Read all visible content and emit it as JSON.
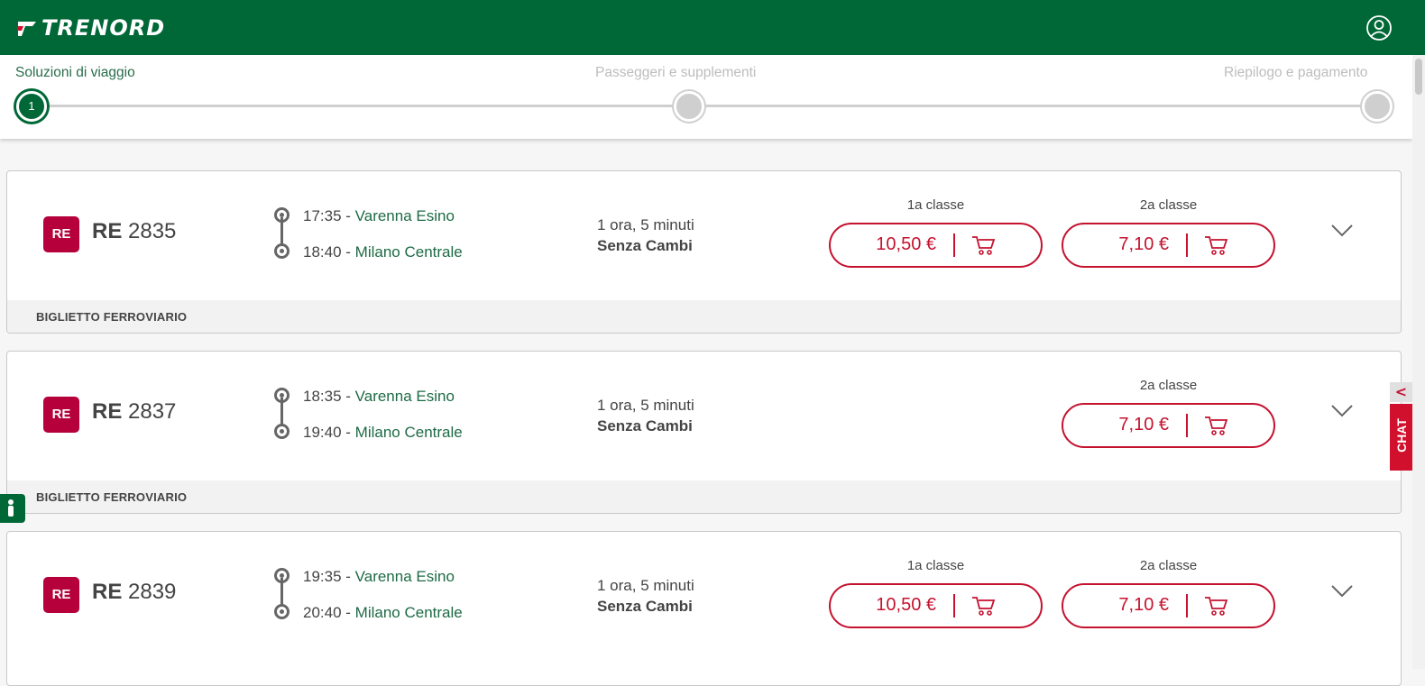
{
  "header": {
    "brand": "TRENORD",
    "user_icon": "user-circle-icon",
    "background": "#006837"
  },
  "stepper": {
    "steps": [
      {
        "label": "Soluzioni di viaggio",
        "number": "1",
        "active": true
      },
      {
        "label": "Passeggeri e supplementi",
        "active": false
      },
      {
        "label": "Riepilogo e pagamento",
        "active": false
      }
    ]
  },
  "results": [
    {
      "badge": "RE",
      "train_type": "RE",
      "train_number": "2835",
      "departure_time": "17:35",
      "departure_station": "Varenna Esino",
      "arrival_time": "18:40",
      "arrival_station": "Milano Centrale",
      "duration": "1 ora, 5 minuti",
      "changes": "Senza Cambi",
      "first_class_label": "1a classe",
      "first_class_price": "10,50 €",
      "second_class_label": "2a classe",
      "second_class_price": "7,10 €",
      "footer": "BIGLIETTO FERROVIARIO"
    },
    {
      "badge": "RE",
      "train_type": "RE",
      "train_number": "2837",
      "departure_time": "18:35",
      "departure_station": "Varenna Esino",
      "arrival_time": "19:40",
      "arrival_station": "Milano Centrale",
      "duration": "1 ora, 5 minuti",
      "changes": "Senza Cambi",
      "second_class_label": "2a classe",
      "second_class_price": "7,10 €",
      "footer": "BIGLIETTO FERROVIARIO"
    },
    {
      "badge": "RE",
      "train_type": "RE",
      "train_number": "2839",
      "departure_time": "19:35",
      "departure_station": "Varenna Esino",
      "arrival_time": "20:40",
      "arrival_station": "Milano Centrale",
      "duration": "1 ora, 5 minuti",
      "changes": "Senza Cambi",
      "first_class_label": "1a classe",
      "first_class_price": "10,50 €",
      "second_class_label": "2a classe",
      "second_class_price": "7,10 €"
    }
  ],
  "chat": {
    "label": "CHAT",
    "collapse_arrow": "<"
  },
  "accessibility": {
    "icon": "accessibility-icon"
  },
  "colors": {
    "brand_green": "#006837",
    "price_red": "#c4122f",
    "badge_red": "#b5003b"
  }
}
